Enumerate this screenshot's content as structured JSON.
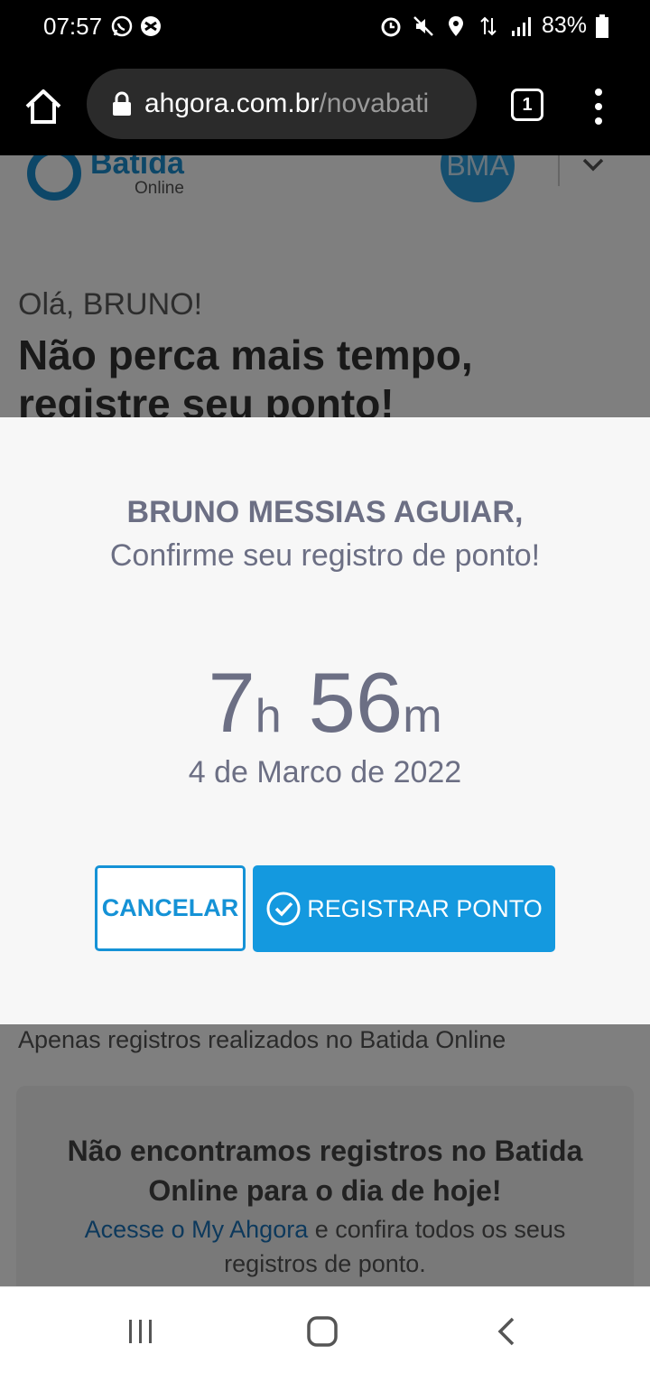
{
  "status_bar": {
    "time": "07:57",
    "battery": "83%",
    "left_icons": [
      "whatsapp-icon",
      "app-notification-icon"
    ],
    "right_icons": [
      "alarm-icon",
      "mute-icon",
      "location-icon",
      "data-icon",
      "signal-icon",
      "battery-icon"
    ]
  },
  "browser": {
    "url_host": "ahgora.com.br",
    "url_path": "/novabati",
    "tab_count": "1"
  },
  "page": {
    "logo_name": "Batida",
    "logo_sub": "Online",
    "avatar_initials": "BMA",
    "greeting": "Olá, BRUNO!",
    "headline": "Não perca mais tempo, registre seu ponto!",
    "only_records": "Apenas registros realizados no Batida Online",
    "empty_title": "Não encontramos registros no Batida Online para o dia de hoje!",
    "empty_link": "Acesse o My Ahgora",
    "empty_text": " e confira todos os seus registros de ponto."
  },
  "modal": {
    "name": "BRUNO MESSIAS AGUIAR,",
    "subtitle": "Confirme seu registro de ponto!",
    "hours": "7",
    "hours_unit": "h",
    "minutes": "56",
    "minutes_unit": "m",
    "date": "4 de Marco de 2022",
    "cancel_label": "CANCELAR",
    "register_label": "REGISTRAR PONTO"
  },
  "colors": {
    "accent": "#1499df",
    "text_muted": "#6c6f84"
  }
}
